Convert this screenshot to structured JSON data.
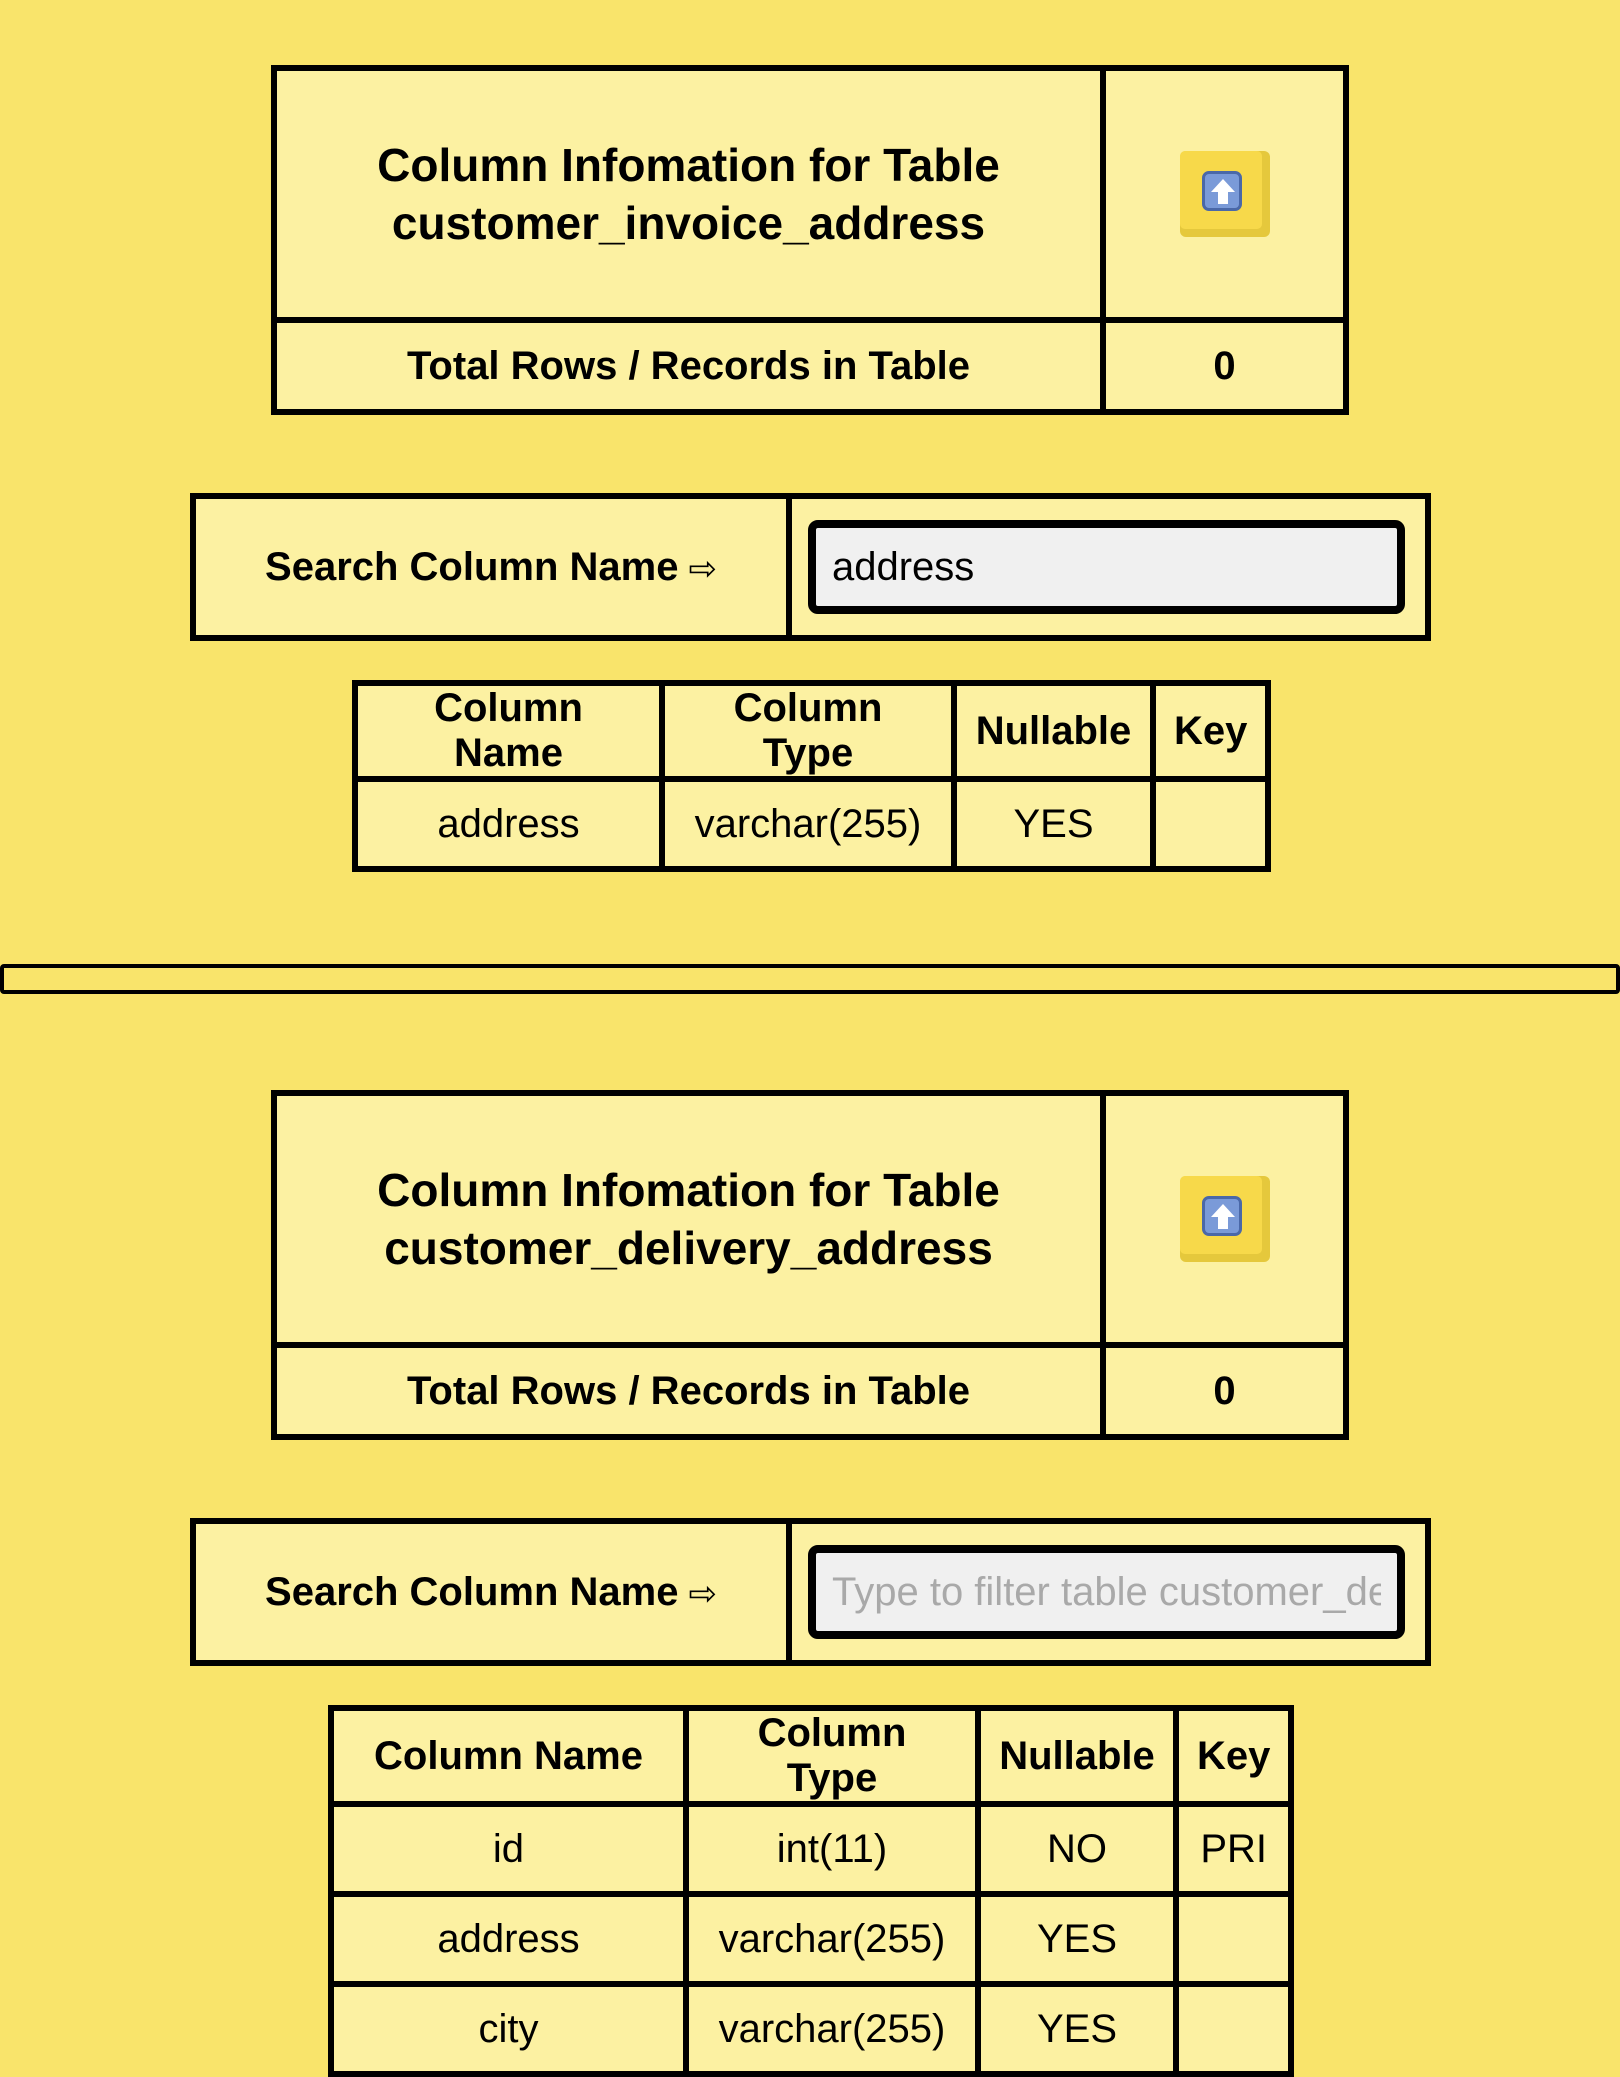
{
  "sections": [
    {
      "title_prefix": "Column Infomation for Table",
      "table_name": "customer_invoice_address",
      "rows_label": "Total Rows / Records in Table",
      "rows_value": "0",
      "search_label": "Search Column Name",
      "search_arrow": "⇨",
      "search_value": "address",
      "search_placeholder": "",
      "columns_header": [
        "Column Name",
        "Column Type",
        "Nullable",
        "Key"
      ],
      "rows": [
        [
          "address",
          "varchar(255)",
          "YES",
          ""
        ]
      ]
    },
    {
      "title_prefix": "Column Infomation for Table",
      "table_name": "customer_delivery_address",
      "rows_label": "Total Rows / Records in Table",
      "rows_value": "0",
      "search_label": "Search Column Name",
      "search_arrow": "⇨",
      "search_value": "",
      "search_placeholder": "Type to filter table customer_delivery_address",
      "columns_header": [
        "Column Name",
        "Column Type",
        "Nullable",
        "Key"
      ],
      "rows": [
        [
          "id",
          "int(11)",
          "NO",
          "PRI"
        ],
        [
          "address",
          "varchar(255)",
          "YES",
          ""
        ],
        [
          "city",
          "varchar(255)",
          "YES",
          ""
        ]
      ]
    }
  ],
  "icons": {
    "scroll_top": "up-arrow-icon"
  },
  "colors": {
    "page_background": "#f9e46b",
    "cell_background": "#fcf1a2",
    "input_background": "#f0f0f0"
  }
}
